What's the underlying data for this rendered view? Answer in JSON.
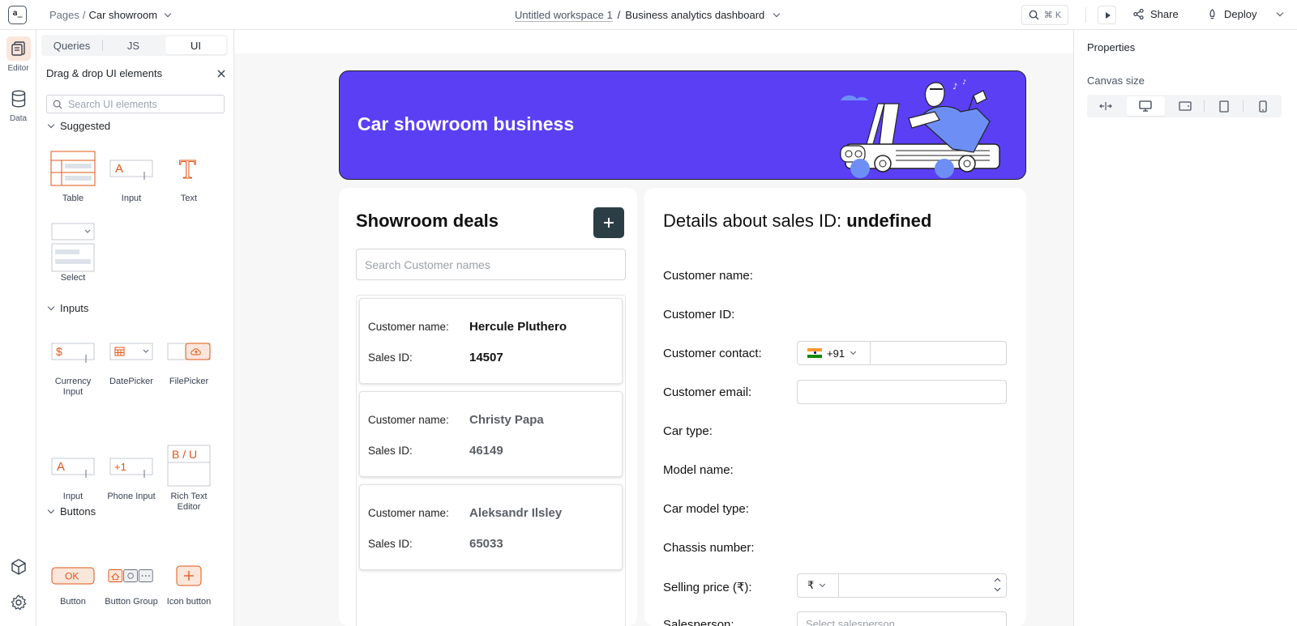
{
  "app": {
    "logo_text": "a_"
  },
  "header": {
    "pages_label": "Pages",
    "breadcrumb_sep": "/",
    "page_name": "Car showroom",
    "workspace": "Untitled workspace 1",
    "center_sep": "/",
    "app_name": "Business analytics dashboard",
    "search_shortcut": "⌘ K",
    "share_label": "Share",
    "deploy_label": "Deploy"
  },
  "rail": {
    "editor_label": "Editor",
    "data_label": "Data"
  },
  "panel": {
    "tabs": [
      {
        "label": "Queries"
      },
      {
        "label": "JS"
      },
      {
        "label": "UI"
      }
    ],
    "active_tab": "UI",
    "heading": "Drag & drop UI elements",
    "search_placeholder": "Search UI elements",
    "sections": {
      "suggested": {
        "label": "Suggested",
        "items": [
          {
            "label": "Table"
          },
          {
            "label": "Input"
          },
          {
            "label": "Text"
          },
          {
            "label": "Select"
          }
        ]
      },
      "inputs": {
        "label": "Inputs",
        "items": [
          {
            "label": "Currency Input"
          },
          {
            "label": "DatePicker"
          },
          {
            "label": "FilePicker"
          },
          {
            "label": "Input"
          },
          {
            "label": "Phone Input"
          },
          {
            "label": "Rich Text Editor"
          }
        ]
      },
      "buttons": {
        "label": "Buttons",
        "items": [
          {
            "label": "Button"
          },
          {
            "label": "Button Group"
          },
          {
            "label": "Icon button"
          }
        ]
      }
    },
    "thumb_text": {
      "input_a": "A",
      "currency": "$",
      "phone": "+1",
      "rich": "B / U",
      "ok": "OK",
      "icon_plus": "+",
      "text_t": "T"
    }
  },
  "canvas": {
    "banner_title": "Car showroom business",
    "deals_title": "Showroom deals",
    "add_icon": "+",
    "search_placeholder": "Search Customer names",
    "deal_labels": {
      "customer": "Customer name:",
      "sales": "Sales ID:"
    },
    "deals": [
      {
        "customer_name": "Hercule Pluthero",
        "sales_id": "14507"
      },
      {
        "customer_name": "Christy Papa",
        "sales_id": "46149"
      },
      {
        "customer_name": "Aleksandr Ilsley",
        "sales_id": "65033"
      }
    ],
    "details": {
      "title_prefix": "Details about sales ID:",
      "title_value": "undefined",
      "fields": [
        {
          "label": "Customer name:"
        },
        {
          "label": "Customer ID:"
        },
        {
          "label": "Customer contact:"
        },
        {
          "label": "Customer email:"
        },
        {
          "label": "Car type:"
        },
        {
          "label": "Model name:"
        },
        {
          "label": "Car model type:"
        },
        {
          "label": "Chassis number:"
        },
        {
          "label": "Selling price (₹):"
        },
        {
          "label": "Salesperson:"
        }
      ],
      "phone_code": "+91",
      "currency_symbol": "₹",
      "salesperson_placeholder": "Select salesperson"
    }
  },
  "properties": {
    "title": "Properties",
    "canvas_size_label": "Canvas size",
    "selected_size": "desktop"
  },
  "colors": {
    "accent": "#e15615",
    "banner": "#5b3ff5",
    "primary_button": "#2c3e45"
  }
}
